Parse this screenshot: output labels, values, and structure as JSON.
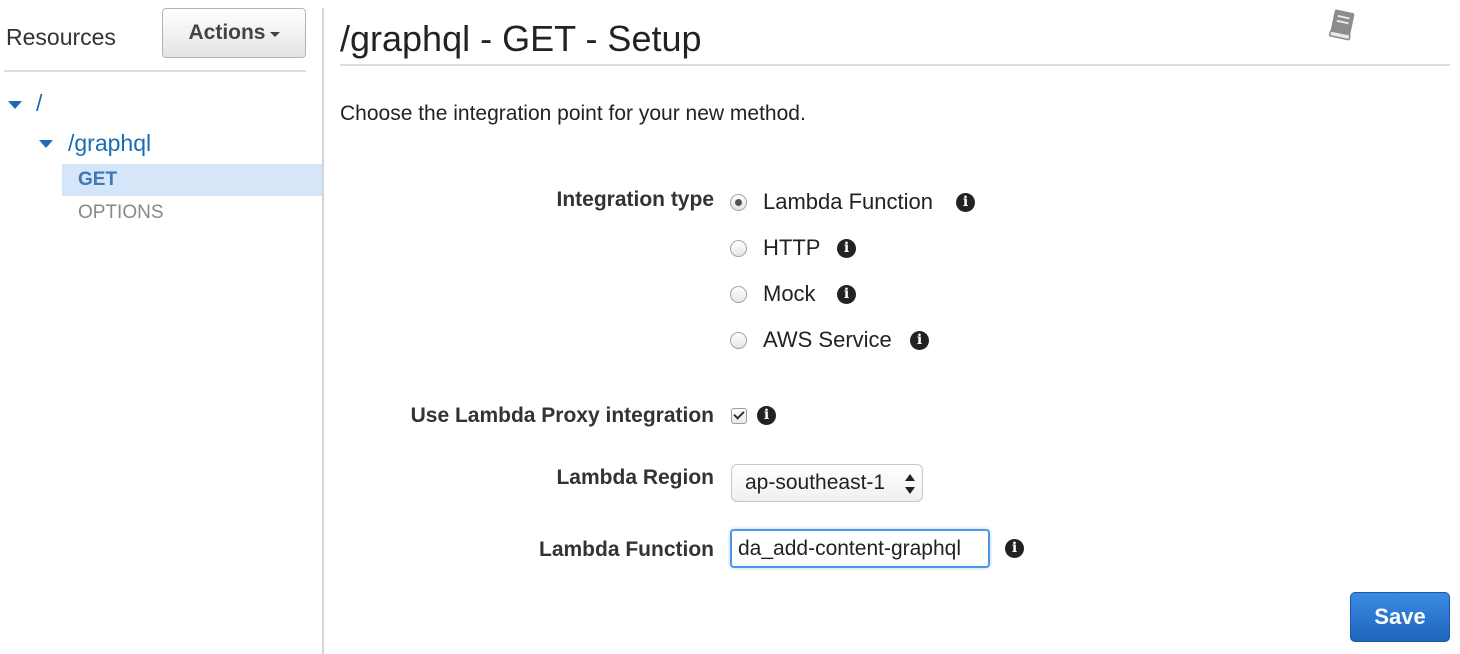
{
  "sidebar": {
    "title": "Resources",
    "actions_label": "Actions",
    "tree": {
      "root_label": "/",
      "child_label": "/graphql",
      "methods": [
        "GET",
        "OPTIONS"
      ],
      "selected_method": "GET"
    }
  },
  "header": {
    "title": "/graphql - GET - Setup",
    "help_icon": "book-icon"
  },
  "main": {
    "intro": "Choose the integration point for your new method.",
    "integration_type": {
      "label": "Integration type",
      "options": [
        "Lambda Function",
        "HTTP",
        "Mock",
        "AWS Service"
      ],
      "selected": "Lambda Function"
    },
    "proxy": {
      "label": "Use Lambda Proxy integration",
      "checked": true
    },
    "region": {
      "label": "Lambda Region",
      "value": "ap-southeast-1"
    },
    "function": {
      "label": "Lambda Function",
      "value": "da_add-content-graphql"
    },
    "save_label": "Save"
  },
  "colors": {
    "link": "#1a6cb6",
    "selected_row_bg": "#d4e6f8",
    "primary_button": "#1f64be",
    "input_focus": "#4d95e8"
  }
}
